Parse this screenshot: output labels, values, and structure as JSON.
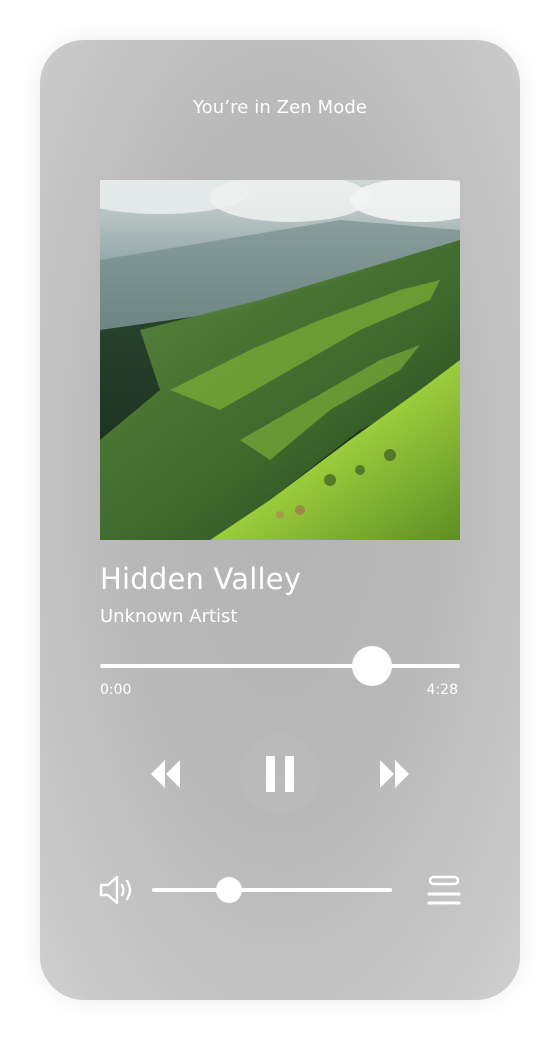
{
  "header": {
    "title": "You’re in Zen Mode"
  },
  "track": {
    "title": "Hidden Valley",
    "artist": "Unknown Artist",
    "artwork": "aerial-green-valley-mountains"
  },
  "progress": {
    "elapsed": "0:00",
    "total": "4:28",
    "fraction": 0.755
  },
  "controls": {
    "rewind_icon": "rewind-icon",
    "pause_icon": "pause-icon",
    "forward_icon": "fast-forward-icon",
    "state": "playing"
  },
  "volume": {
    "icon": "speaker-icon",
    "fraction": 0.32
  },
  "queue": {
    "icon": "queue-list-icon"
  },
  "colors": {
    "foreground": "#ffffff",
    "card_background": "#b8b8b8"
  }
}
